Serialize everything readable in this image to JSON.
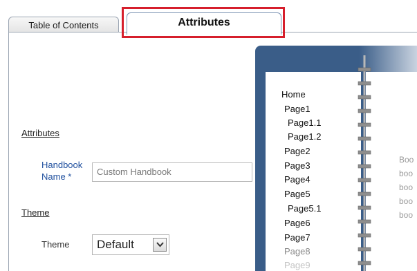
{
  "tabs": {
    "toc_label": "Table of Contents",
    "attributes_label": "Attributes"
  },
  "form": {
    "attributes_heading": "Attributes",
    "handbook_label_line1": "Handbook",
    "handbook_label_line2": "Name *",
    "handbook_name_value": "Custom Handbook",
    "theme_heading": "Theme",
    "theme_label": "Theme",
    "theme_value": "Default"
  },
  "preview": {
    "toc_items": [
      "Home",
      "Page1",
      "Page1.1",
      "Page1.2",
      "Page2",
      "Page3",
      "Page4",
      "Page5",
      "Page5.1",
      "Page6",
      "Page7",
      "Page8",
      "Page9"
    ],
    "body_lines": [
      "Boo",
      "boo",
      "boo",
      "boo",
      "boo"
    ]
  },
  "colors": {
    "highlight": "#d61f2c",
    "preview_frame": "#3a5d88",
    "label_blue": "#1f4f9e"
  },
  "icons": {
    "dropdown": "chevron-down-icon",
    "binder": "spiral-binding-icon"
  }
}
